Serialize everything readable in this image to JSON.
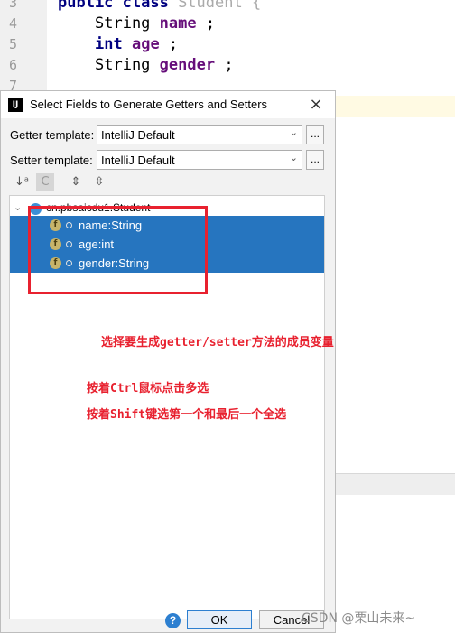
{
  "editor": {
    "line_numbers": [
      "3",
      "4",
      "5",
      "6",
      "7"
    ],
    "lines": [
      {
        "kw": "public class",
        "rest": " Student {"
      },
      {
        "type": "String",
        "field": "name",
        "end": " ;"
      },
      {
        "kw": "int",
        "field": "age",
        "end": " ;"
      },
      {
        "type": "String",
        "field": "gender",
        "end": " ;"
      }
    ]
  },
  "dialog": {
    "title": "Select Fields to Generate Getters and Setters",
    "app_icon": "IJ",
    "close_glyph": "×",
    "getter_label": "Getter template:",
    "getter_value": "IntelliJ Default",
    "setter_label": "Setter template:",
    "setter_value": "IntelliJ Default",
    "dots": "...",
    "toolbar": {
      "sort_glyph": "↓ᵃ",
      "class_glyph": "C",
      "expand_glyph": "⇕",
      "collapse_glyph": "⇳"
    },
    "tree": {
      "root_label": "cn.pbsaicdu1.Student",
      "fields": [
        {
          "label": "name:String"
        },
        {
          "label": "age:int"
        },
        {
          "label": "gender:String"
        }
      ],
      "field_icon": "f"
    },
    "help_glyph": "?",
    "ok_label": "OK",
    "cancel_label": "Cancel"
  },
  "annotations": [
    "选择要生成getter/setter方法的成员变量",
    "按着Ctrl鼠标点击多选",
    "按着Shift键选第一个和最后一个全选"
  ],
  "watermark": "CSDN @栗山未来~",
  "colors": {
    "selection": "#2675bf",
    "annotation": "#e8212f",
    "keyword": "#000080",
    "field": "#660e7a"
  }
}
